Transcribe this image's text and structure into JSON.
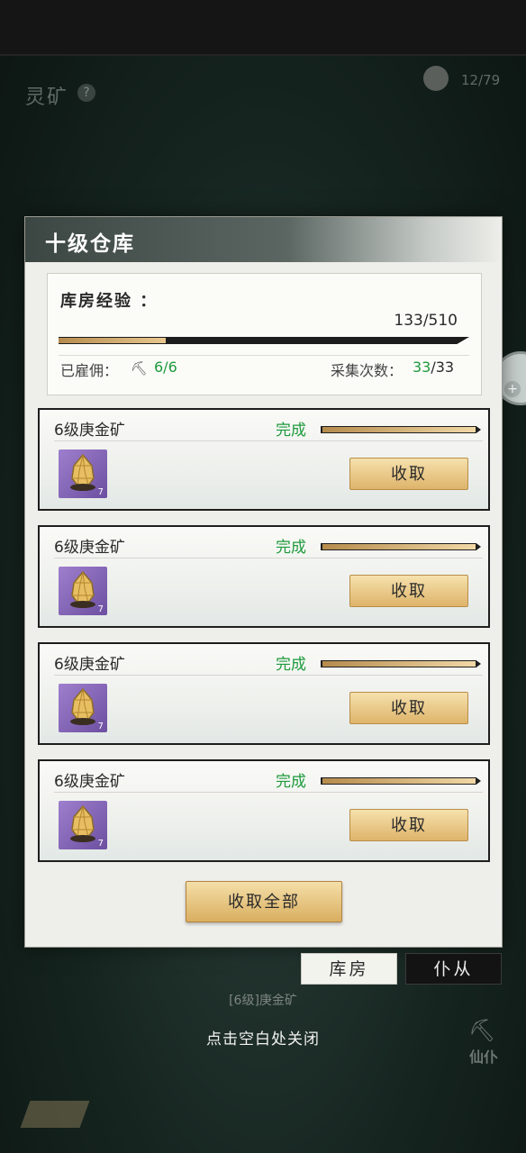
{
  "header": {
    "title": "灵矿",
    "help_icon": "?",
    "counter": "12/79"
  },
  "panel": {
    "title": "十级仓库",
    "exp": {
      "label": "库房经验 ：",
      "value": "133/510",
      "progress": 0.26
    },
    "hired": {
      "label": "已雇佣：",
      "value": "6/6"
    },
    "gather": {
      "label": "采集次数：",
      "done": "33",
      "total": "/33"
    },
    "tasks": [
      {
        "name": "6级庚金矿",
        "status": "完成",
        "item_count": "7",
        "button": "收取",
        "progress": 1.0
      },
      {
        "name": "6级庚金矿",
        "status": "完成",
        "item_count": "7",
        "button": "收取",
        "progress": 1.0
      },
      {
        "name": "6级庚金矿",
        "status": "完成",
        "item_count": "7",
        "button": "收取",
        "progress": 1.0
      },
      {
        "name": "6级庚金矿",
        "status": "完成",
        "item_count": "7",
        "button": "收取",
        "progress": 1.0
      }
    ],
    "collect_all": "收取全部"
  },
  "tabs": {
    "storage": "库房",
    "servant": "仆从"
  },
  "ore_caption": "[6级]庚金矿",
  "close_hint": "点击空白处关闭",
  "xianpu": "仙仆",
  "colors": {
    "complete_green": "#1e9a3d",
    "gold_button": "#deb46a",
    "panel_bg": "#eeeeea"
  }
}
